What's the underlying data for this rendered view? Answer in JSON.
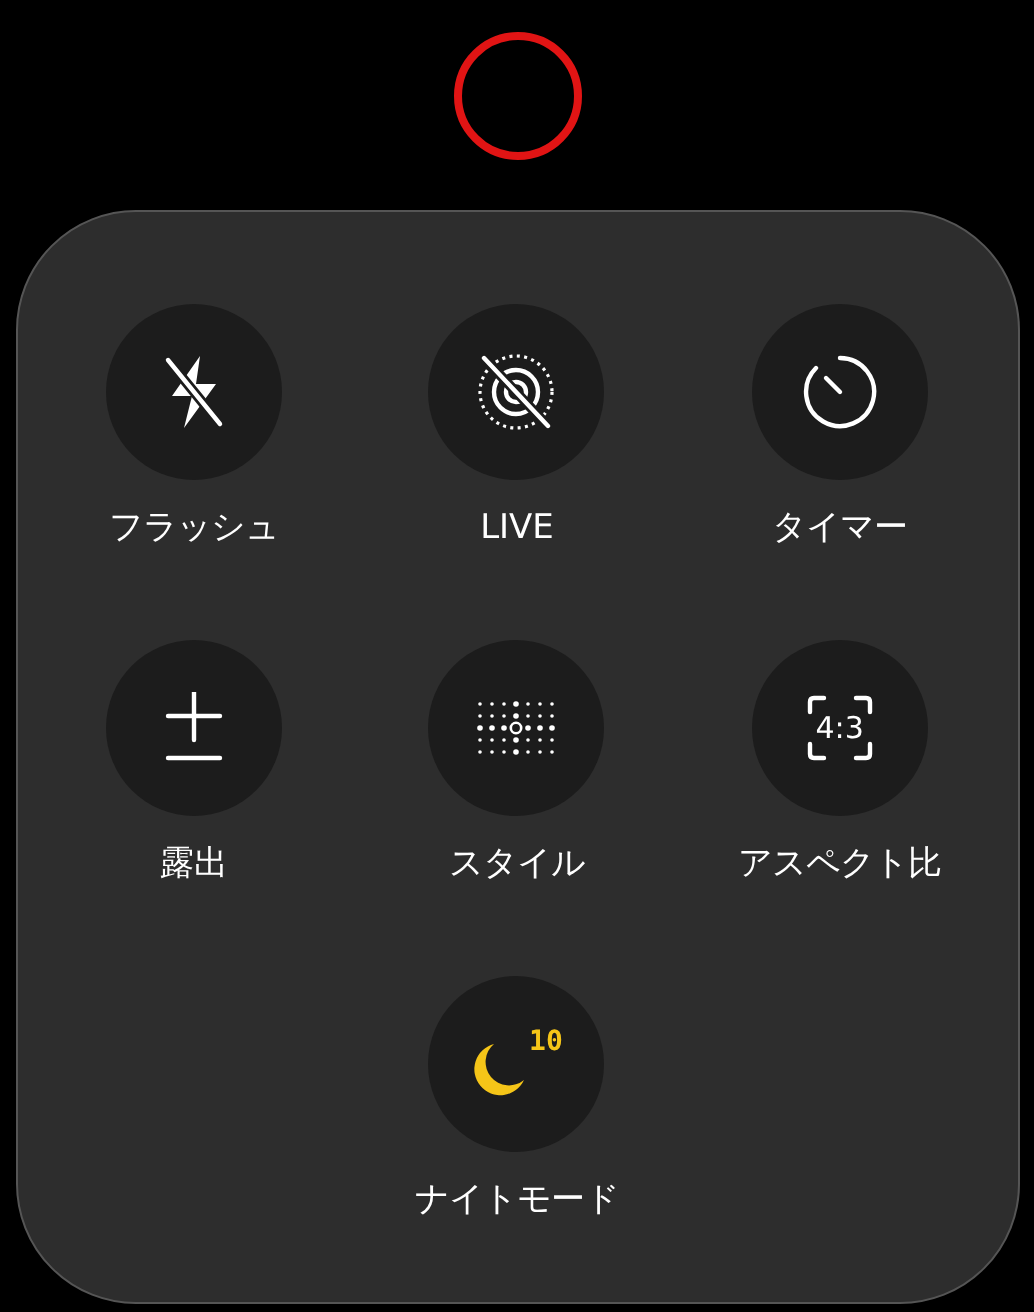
{
  "controls": [
    {
      "kind": "flash_off",
      "label": "フラッシュ"
    },
    {
      "kind": "live_off",
      "label": "LIVE"
    },
    {
      "kind": "timer",
      "label": "タイマー"
    },
    {
      "kind": "exposure",
      "label": "露出"
    },
    {
      "kind": "style",
      "label": "スタイル"
    },
    {
      "kind": "aspect",
      "label": "アスペクト比",
      "icon_text": "4:3"
    },
    {
      "kind": "night",
      "label": "ナイトモード",
      "icon_text": "10"
    }
  ]
}
